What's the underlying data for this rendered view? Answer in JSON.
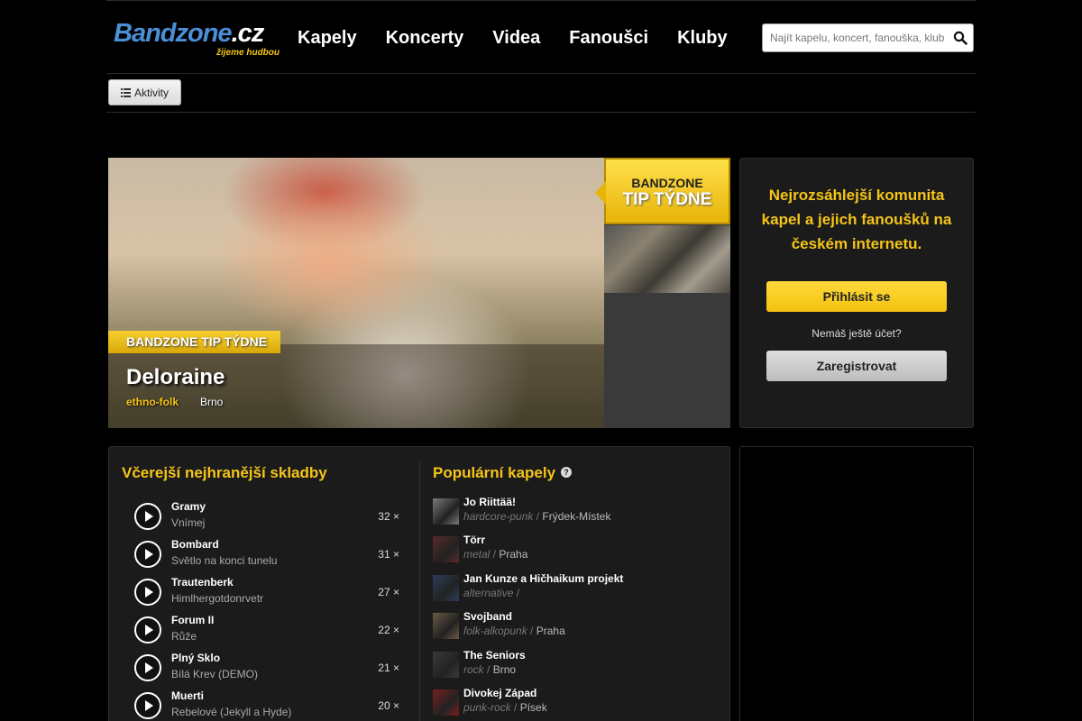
{
  "header": {
    "logo_main": "Bandzone",
    "logo_tld": ".cz",
    "logo_tagline": "žijeme hudbou",
    "nav": [
      "Kapely",
      "Koncerty",
      "Videa",
      "Fanoušci",
      "Kluby"
    ],
    "search_placeholder": "Najít kapelu, koncert, fanouška, klub"
  },
  "subbar": {
    "activities_label": "Aktivity"
  },
  "hero": {
    "tag": "BANDZONE TIP TÝDNE",
    "band": "Deloraine",
    "genre": "ethno-folk",
    "city": "Brno"
  },
  "tip_badge": {
    "line1": "BANDZONE",
    "line2": "TIP TÝDNE"
  },
  "login": {
    "text": "Nejrozsáhlejší komunita kapel a jejich fanoušků na českém internetu.",
    "login_label": "Přihlásit se",
    "no_account": "Nemáš ještě účet?",
    "register_label": "Zaregistrovat"
  },
  "tracks": {
    "title": "Včerejší nejhranější skladby",
    "items": [
      {
        "band": "Gramy",
        "song": "Vnímej",
        "count": "32 ×"
      },
      {
        "band": "Bombard",
        "song": "Světlo na konci tunelu",
        "count": "31 ×"
      },
      {
        "band": "Trautenberk",
        "song": "Himlhergotdonrvetr",
        "count": "27 ×"
      },
      {
        "band": "Forum II",
        "song": "Růže",
        "count": "22 ×"
      },
      {
        "band": "Plný Sklo",
        "song": "Bílá Krev (DEMO)",
        "count": "21 ×"
      },
      {
        "band": "Muerti",
        "song": "Rebelové (Jekyll a Hyde)",
        "count": "20 ×"
      }
    ]
  },
  "bands": {
    "title": "Populární kapely",
    "help_glyph": "?",
    "items": [
      {
        "name": "Jo Riittää!",
        "genre": "hardcore-punk",
        "sep": " / ",
        "city": "Frýdek-Místek",
        "color": "#7a7a7a"
      },
      {
        "name": "Törr",
        "genre": "metal",
        "sep": " / ",
        "city": "Praha",
        "color": "#5a2a2a"
      },
      {
        "name": "Jan Kunze a Hičhaikum projekt",
        "genre": "alternative",
        "sep": " /",
        "city": "",
        "color": "#2e3c5c"
      },
      {
        "name": "Svojband",
        "genre": "folk-alkopunk",
        "sep": " / ",
        "city": "Praha",
        "color": "#6b5a44"
      },
      {
        "name": "The Seniors",
        "genre": "rock",
        "sep": " / ",
        "city": "Brno",
        "color": "#3a3a3a"
      },
      {
        "name": "Divokej Západ",
        "genre": "punk-rock",
        "sep": " / ",
        "city": "Písek",
        "color": "#7a2020"
      }
    ]
  }
}
